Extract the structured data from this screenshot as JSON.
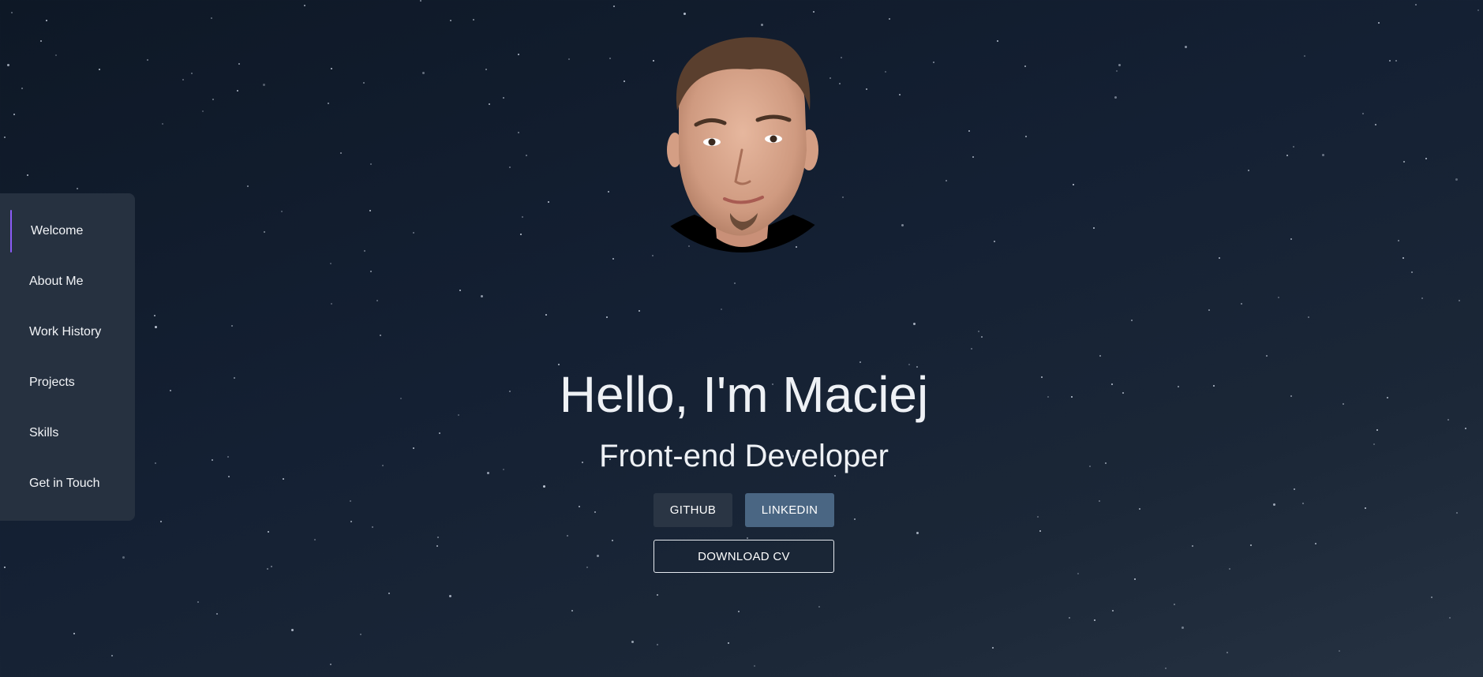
{
  "nav": {
    "items": [
      {
        "label": "Welcome",
        "active": true
      },
      {
        "label": "About Me",
        "active": false
      },
      {
        "label": "Work History",
        "active": false
      },
      {
        "label": "Projects",
        "active": false
      },
      {
        "label": "Skills",
        "active": false
      },
      {
        "label": "Get in Touch",
        "active": false
      }
    ]
  },
  "hero": {
    "headline": "Hello, I'm Maciej",
    "subtitle": "Front-end Developer",
    "buttons": {
      "github": "GITHUB",
      "linkedin": "LINKEDIN",
      "download_cv": "DOWNLOAD CV"
    }
  },
  "colors": {
    "background_dark": "#0e1826",
    "sidebar": "#263140",
    "active_indicator": "#8b5cf6",
    "github_button": "#2a3544",
    "linkedin_button": "#4a6683",
    "text": "#eef1f5"
  }
}
